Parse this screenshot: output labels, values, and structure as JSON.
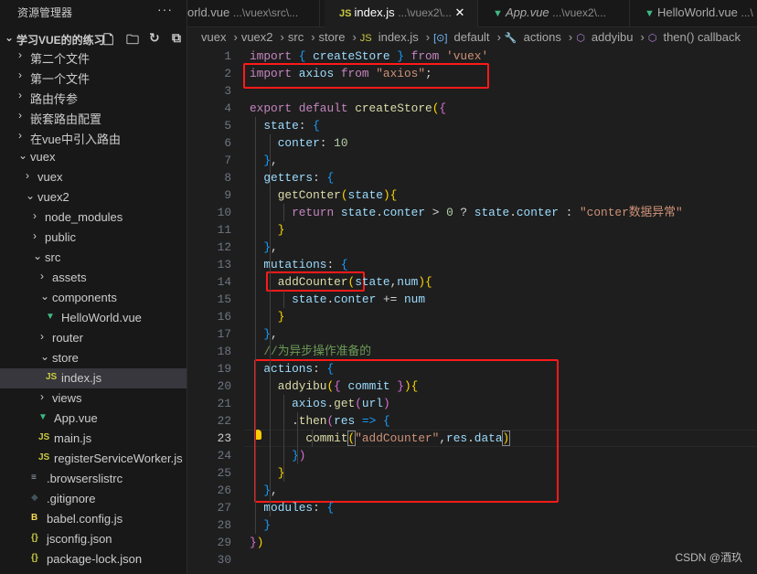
{
  "sidebar": {
    "title": "资源管理器",
    "more": "···",
    "root": "学习VUE的的练习",
    "root_actions": [
      {
        "icon": "new-file-icon",
        "glyph": "🗋"
      },
      {
        "icon": "new-folder-icon",
        "glyph": "🗀"
      },
      {
        "icon": "refresh-icon",
        "glyph": "↻"
      },
      {
        "icon": "collapse-all-icon",
        "glyph": "⧉"
      }
    ],
    "tree": [
      {
        "name": "第二个文件",
        "depth": 0,
        "type": "folder",
        "open": false
      },
      {
        "name": "第一个文件",
        "depth": 0,
        "type": "folder",
        "open": false
      },
      {
        "name": "路由传参",
        "depth": 0,
        "type": "folder",
        "open": false
      },
      {
        "name": "嵌套路由配置",
        "depth": 0,
        "type": "folder",
        "open": false
      },
      {
        "name": "在vue中引入路由",
        "depth": 0,
        "type": "folder",
        "open": false
      },
      {
        "name": "vuex",
        "depth": 0,
        "type": "folder",
        "open": true
      },
      {
        "name": "vuex",
        "depth": 1,
        "type": "folder",
        "open": false
      },
      {
        "name": "vuex2",
        "depth": 1,
        "type": "folder",
        "open": true
      },
      {
        "name": "node_modules",
        "depth": 2,
        "type": "folder",
        "open": false
      },
      {
        "name": "public",
        "depth": 2,
        "type": "folder",
        "open": false
      },
      {
        "name": "src",
        "depth": 2,
        "type": "folder",
        "open": true
      },
      {
        "name": "assets",
        "depth": 3,
        "type": "folder",
        "open": false
      },
      {
        "name": "components",
        "depth": 3,
        "type": "folder",
        "open": true
      },
      {
        "name": "HelloWorld.vue",
        "depth": 4,
        "type": "vue"
      },
      {
        "name": "router",
        "depth": 3,
        "type": "folder",
        "open": false
      },
      {
        "name": "store",
        "depth": 3,
        "type": "folder",
        "open": true
      },
      {
        "name": "index.js",
        "depth": 4,
        "type": "js",
        "selected": true
      },
      {
        "name": "views",
        "depth": 3,
        "type": "folder",
        "open": false
      },
      {
        "name": "App.vue",
        "depth": 3,
        "type": "vue"
      },
      {
        "name": "main.js",
        "depth": 3,
        "type": "js"
      },
      {
        "name": "registerServiceWorker.js",
        "depth": 3,
        "type": "js"
      },
      {
        "name": ".browserslistrc",
        "depth": 2,
        "type": "text"
      },
      {
        "name": ".gitignore",
        "depth": 2,
        "type": "git"
      },
      {
        "name": "babel.config.js",
        "depth": 2,
        "type": "babel"
      },
      {
        "name": "jsconfig.json",
        "depth": 2,
        "type": "json"
      },
      {
        "name": "package-lock.json",
        "depth": 2,
        "type": "json"
      }
    ]
  },
  "tabs": [
    {
      "name": "orld.vue",
      "desc": "...\\vuex\\src\\...",
      "icon": "none",
      "active": false
    },
    {
      "name": "index.js",
      "desc": "...\\vuex2\\...",
      "icon": "js",
      "active": true,
      "close": "✕"
    },
    {
      "name": "App.vue",
      "desc": "...\\vuex2\\...",
      "icon": "vue",
      "active": false,
      "italic": true
    },
    {
      "name": "HelloWorld.vue",
      "desc": "...\\",
      "icon": "vue",
      "active": false
    }
  ],
  "breadcrumb": [
    "vuex",
    "vuex2",
    "src",
    "store",
    "index.js",
    "default",
    "actions",
    "addyibu",
    "then() callback"
  ],
  "editor": {
    "current_line": 23,
    "lines": [
      [
        [
          "import ",
          "k"
        ],
        [
          "{ ",
          "b3"
        ],
        [
          "createStore ",
          "v"
        ],
        [
          "} ",
          "b3"
        ],
        [
          "from ",
          "k"
        ],
        [
          "'vuex'",
          "s"
        ]
      ],
      [
        [
          "import ",
          "k"
        ],
        [
          "axios ",
          "v"
        ],
        [
          "from ",
          "k"
        ],
        [
          "\"axios\"",
          "s"
        ],
        [
          ";",
          "p"
        ]
      ],
      [],
      [
        [
          "export ",
          "k"
        ],
        [
          "default ",
          "k"
        ],
        [
          "createStore",
          "f"
        ],
        [
          "(",
          "b1"
        ],
        [
          "{",
          "b2"
        ]
      ],
      [
        [
          "  state",
          "v"
        ],
        [
          ": ",
          "p"
        ],
        [
          "{",
          "b3"
        ]
      ],
      [
        [
          "    conter",
          "v"
        ],
        [
          ": ",
          "p"
        ],
        [
          "10",
          "n"
        ]
      ],
      [
        [
          "  ",
          "p"
        ],
        [
          "}",
          "b3"
        ],
        [
          ",",
          "p"
        ]
      ],
      [
        [
          "  getters",
          "v"
        ],
        [
          ": ",
          "p"
        ],
        [
          "{",
          "b3"
        ]
      ],
      [
        [
          "    getConter",
          "f"
        ],
        [
          "(",
          "b1"
        ],
        [
          "state",
          "v"
        ],
        [
          ")",
          "b1"
        ],
        [
          "{",
          "b1"
        ]
      ],
      [
        [
          "      return ",
          "k"
        ],
        [
          "state",
          "v"
        ],
        [
          ".",
          "p"
        ],
        [
          "conter ",
          "v"
        ],
        [
          "> ",
          "p"
        ],
        [
          "0 ",
          "n"
        ],
        [
          "? ",
          "p"
        ],
        [
          "state",
          "v"
        ],
        [
          ".",
          "p"
        ],
        [
          "conter ",
          "v"
        ],
        [
          ": ",
          "p"
        ],
        [
          "\"conter数据异常\"",
          "s"
        ]
      ],
      [
        [
          "    ",
          "p"
        ],
        [
          "}",
          "b1"
        ]
      ],
      [
        [
          "  ",
          "p"
        ],
        [
          "}",
          "b3"
        ],
        [
          ",",
          "p"
        ]
      ],
      [
        [
          "  mutations",
          "v"
        ],
        [
          ": ",
          "p"
        ],
        [
          "{",
          "b3"
        ]
      ],
      [
        [
          "    addCounter",
          "f"
        ],
        [
          "(",
          "b1"
        ],
        [
          "state",
          "v"
        ],
        [
          ",",
          "p"
        ],
        [
          "num",
          "v"
        ],
        [
          ")",
          "b1"
        ],
        [
          "{",
          "b1"
        ]
      ],
      [
        [
          "      state",
          "v"
        ],
        [
          ".",
          "p"
        ],
        [
          "conter ",
          "v"
        ],
        [
          "+= ",
          "p"
        ],
        [
          "num",
          "v"
        ]
      ],
      [
        [
          "    ",
          "p"
        ],
        [
          "}",
          "b1"
        ]
      ],
      [
        [
          "  ",
          "p"
        ],
        [
          "}",
          "b3"
        ],
        [
          ",",
          "p"
        ]
      ],
      [
        [
          "  //为异步操作准备的",
          "c"
        ]
      ],
      [
        [
          "  actions",
          "v"
        ],
        [
          ": ",
          "p"
        ],
        [
          "{",
          "b3"
        ]
      ],
      [
        [
          "    addyibu",
          "f"
        ],
        [
          "(",
          "b1"
        ],
        [
          "{ ",
          "b2"
        ],
        [
          "commit ",
          "v"
        ],
        [
          "}",
          "b2"
        ],
        [
          ")",
          "b1"
        ],
        [
          "{",
          "b1"
        ]
      ],
      [
        [
          "      axios",
          "v"
        ],
        [
          ".",
          "p"
        ],
        [
          "get",
          "f"
        ],
        [
          "(",
          "b2"
        ],
        [
          "url",
          "v"
        ],
        [
          ")",
          "b2"
        ]
      ],
      [
        [
          "      .",
          "p"
        ],
        [
          "then",
          "f"
        ],
        [
          "(",
          "b2"
        ],
        [
          "res ",
          "v"
        ],
        [
          "=> ",
          "b3"
        ],
        [
          "{",
          "b3"
        ]
      ],
      [
        [
          "        commit",
          "f"
        ],
        [
          "(",
          "b1 bm"
        ],
        [
          "\"addCounter\"",
          "s"
        ],
        [
          ",",
          "p"
        ],
        [
          "res",
          "v"
        ],
        [
          ".",
          "p"
        ],
        [
          "data",
          "v"
        ],
        [
          ")",
          "b1 bm"
        ]
      ],
      [
        [
          "      ",
          "p"
        ],
        [
          "}",
          "b3"
        ],
        [
          ")",
          "b2"
        ]
      ],
      [
        [
          "    ",
          "p"
        ],
        [
          "}",
          "b1"
        ]
      ],
      [
        [
          "  ",
          "p"
        ],
        [
          "}",
          "b3"
        ],
        [
          ",",
          "p"
        ]
      ],
      [
        [
          "  modules",
          "v"
        ],
        [
          ": ",
          "p"
        ],
        [
          "{",
          "b3"
        ]
      ],
      [
        [
          "  ",
          "p"
        ],
        [
          "}",
          "b3"
        ]
      ],
      [
        [
          "}",
          "b2"
        ],
        [
          ")",
          "b1"
        ]
      ],
      []
    ]
  },
  "watermark": "CSDN @酒玖",
  "colors": {
    "accent_box": "#ff1a1a",
    "js": "#cbcb41",
    "vue": "#41b883"
  }
}
